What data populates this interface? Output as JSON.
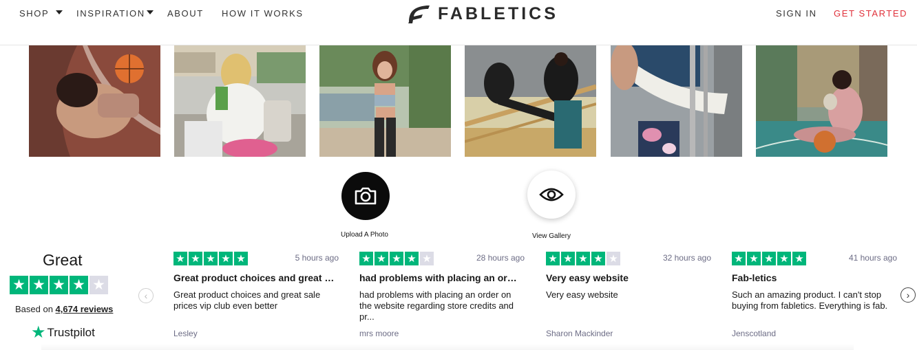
{
  "nav": {
    "shop": "SHOP",
    "inspiration": "INSPIRATION",
    "about": "ABOUT",
    "how_it_works": "HOW IT WORKS",
    "sign_in": "SIGN IN",
    "get_started": "GET STARTED"
  },
  "brand": {
    "name": "FABLETICS",
    "accent": "#e0303a"
  },
  "actions": {
    "upload_label": "Upload A Photo",
    "gallery_label": "View Gallery"
  },
  "trustpilot": {
    "rating_text": "Great",
    "stars": 4,
    "based_on": "Based on ",
    "reviews_count": "4,674 reviews",
    "brand": "Trustpilot",
    "star_color": "#00b67a"
  },
  "reviews": [
    {
      "stars": 5,
      "time": "5 hours ago",
      "title": "Great product choices and great …",
      "body": "Great product choices and great sale prices vip club even better",
      "author": "Lesley"
    },
    {
      "stars": 4,
      "time": "28 hours ago",
      "title": "had problems with placing an or…",
      "body": "had problems with placing an order on the website regarding store credits and pr...",
      "author": "mrs moore"
    },
    {
      "stars": 4,
      "time": "32 hours ago",
      "title": "Very easy website",
      "body": "Very easy website",
      "author": "Sharon Mackinder"
    },
    {
      "stars": 5,
      "time": "41 hours ago",
      "title": "Fab-letics",
      "body": "Such an amazing product. I can't stop buying from fabletics. Everything is fab.",
      "author": "Jenscotland"
    }
  ]
}
